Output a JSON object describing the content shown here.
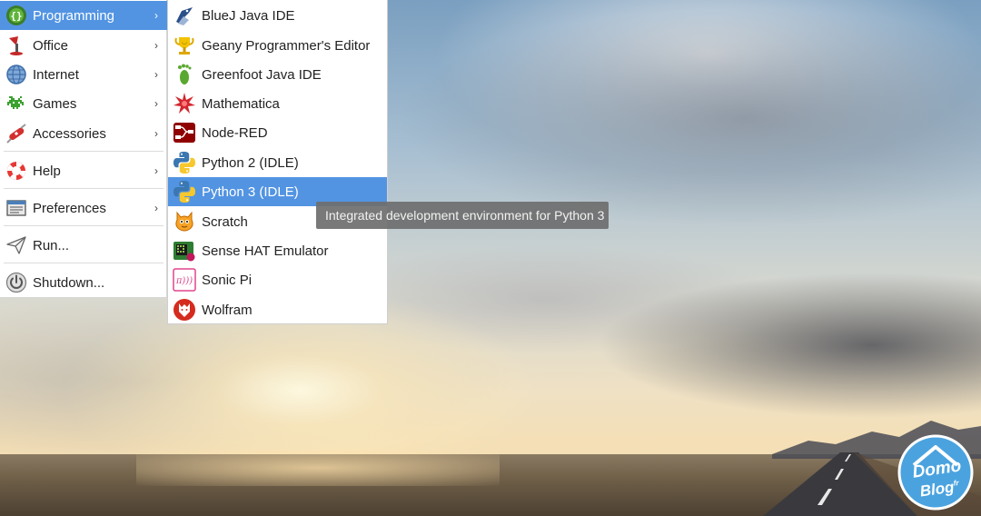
{
  "main_menu": {
    "items": [
      {
        "label": "Programming",
        "icon": "programming-icon",
        "has_submenu": true
      },
      {
        "label": "Office",
        "icon": "office-icon",
        "has_submenu": true
      },
      {
        "label": "Internet",
        "icon": "globe-icon",
        "has_submenu": true
      },
      {
        "label": "Games",
        "icon": "space-invader-icon",
        "has_submenu": true
      },
      {
        "label": "Accessories",
        "icon": "swiss-knife-icon",
        "has_submenu": true
      },
      {
        "label": "Help",
        "icon": "lifebuoy-icon",
        "has_submenu": true
      },
      {
        "label": "Preferences",
        "icon": "preferences-icon",
        "has_submenu": true
      },
      {
        "label": "Run...",
        "icon": "paper-plane-icon",
        "has_submenu": false
      },
      {
        "label": "Shutdown...",
        "icon": "power-icon",
        "has_submenu": false
      }
    ],
    "arrow": "›",
    "active_item": "Programming"
  },
  "sub_menu": {
    "items": [
      {
        "label": "BlueJ Java IDE",
        "icon": "bluej-bird-icon"
      },
      {
        "label": "Geany Programmer's Editor",
        "icon": "geany-trophy-icon"
      },
      {
        "label": "Greenfoot Java IDE",
        "icon": "greenfoot-footprint-icon"
      },
      {
        "label": "Mathematica",
        "icon": "mathematica-star-icon"
      },
      {
        "label": "Node-RED",
        "icon": "node-red-icon"
      },
      {
        "label": "Python 2 (IDLE)",
        "icon": "python-icon"
      },
      {
        "label": "Python 3 (IDLE)",
        "icon": "python-icon"
      },
      {
        "label": "Scratch",
        "icon": "scratch-cat-icon"
      },
      {
        "label": "Sense HAT Emulator",
        "icon": "sense-hat-icon"
      },
      {
        "label": "Sonic Pi",
        "icon": "sonic-pi-icon"
      },
      {
        "label": "Wolfram",
        "icon": "wolfram-icon"
      }
    ],
    "active_item": "Python 3 (IDLE)"
  },
  "tooltip": {
    "text": "Integrated development environment for Python 3"
  },
  "watermark": {
    "line1": "Domo",
    "line2": "Blog",
    "suffix": "fr"
  },
  "colors": {
    "highlight": "#5294e2",
    "menu_bg": "#ffffff",
    "tooltip_bg": "#6e6e6e"
  }
}
